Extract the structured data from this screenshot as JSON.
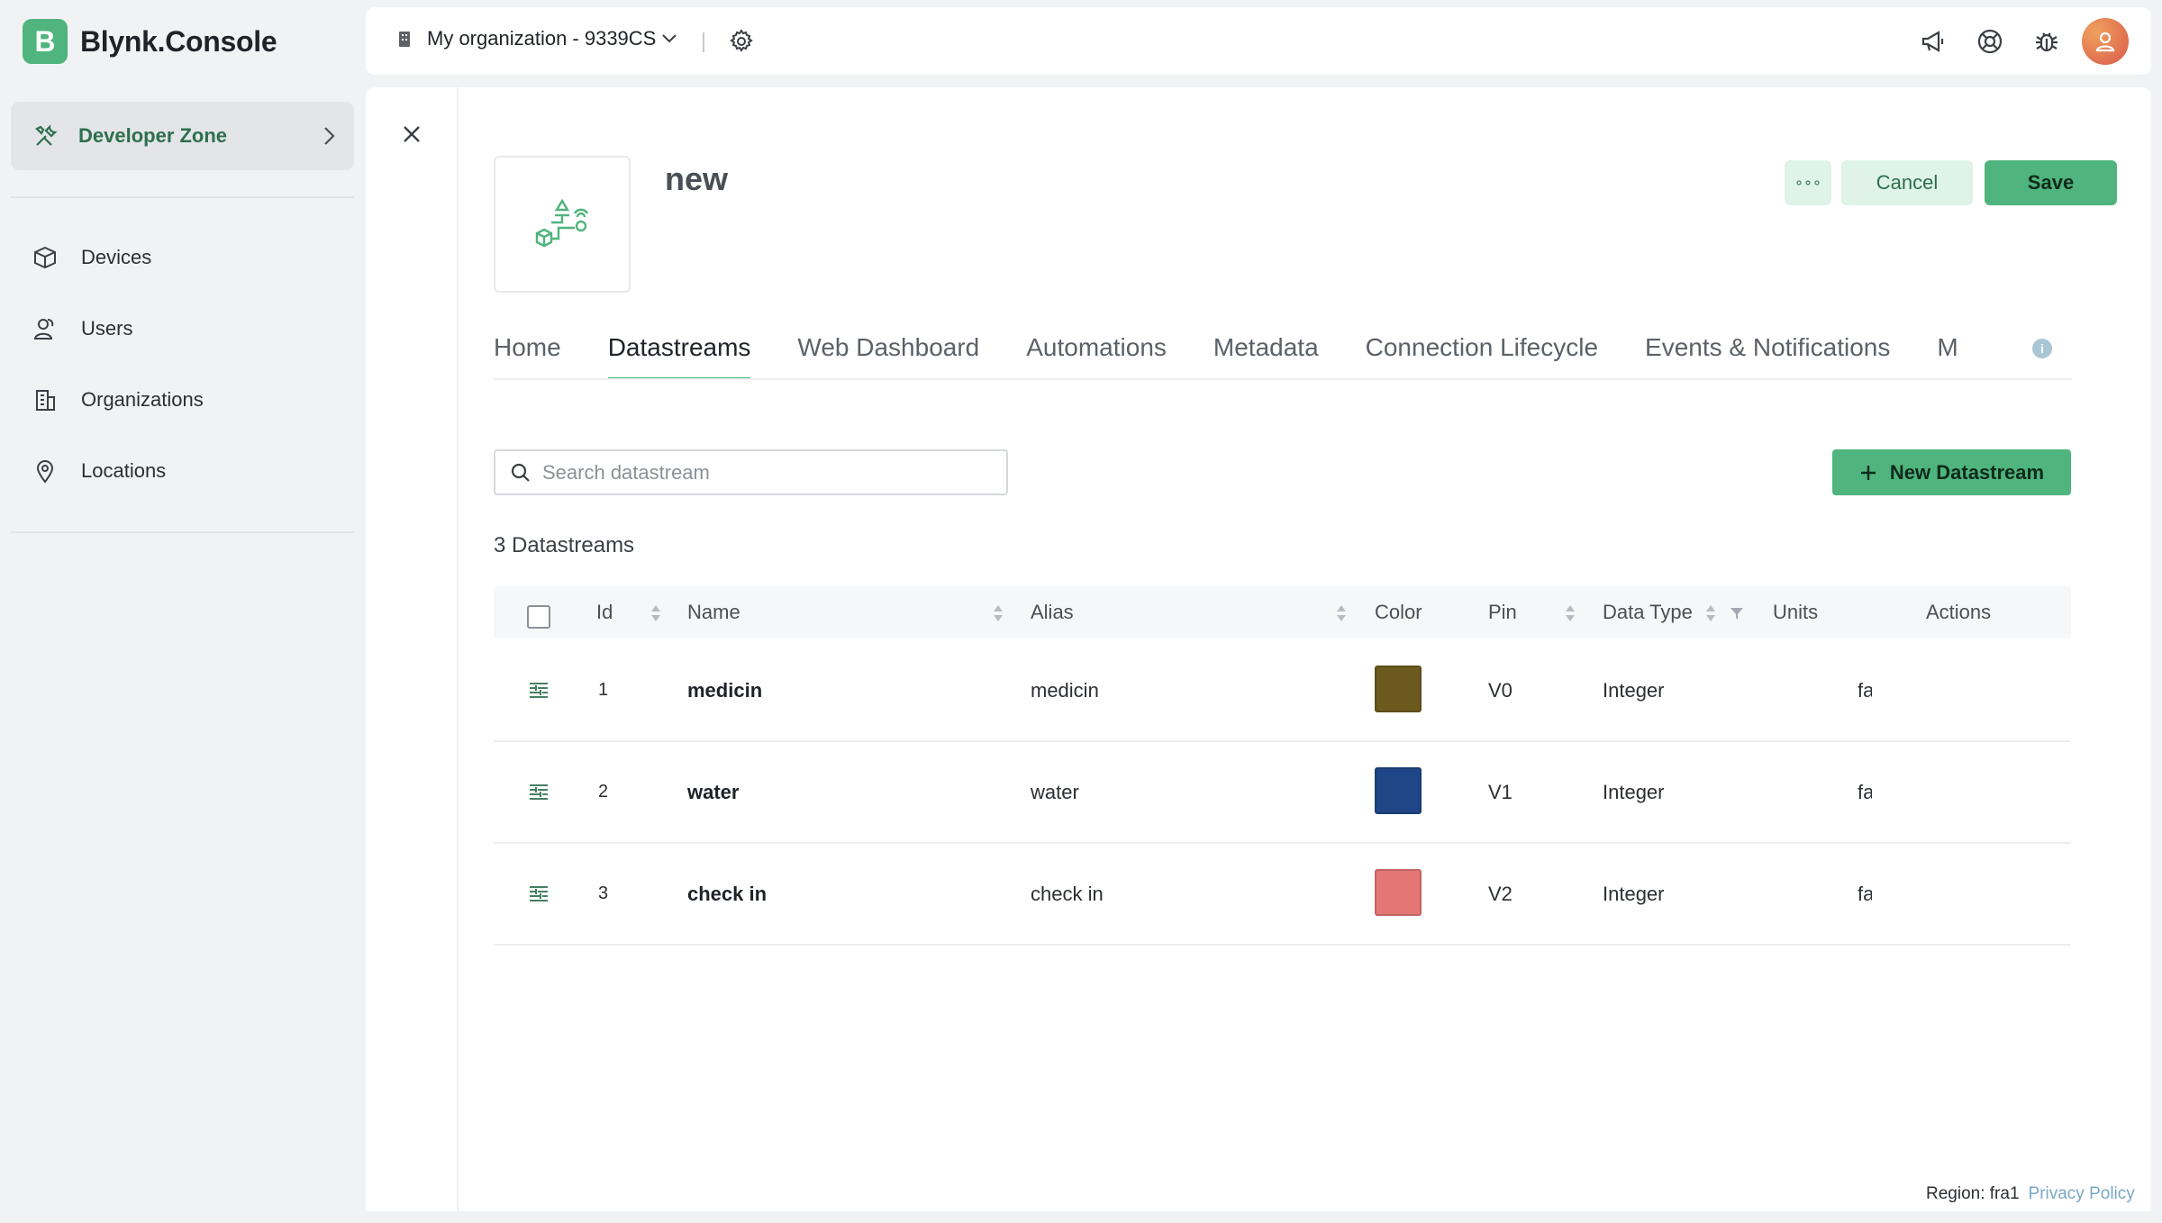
{
  "app": {
    "logo_letter": "B",
    "name": "Blynk.Console"
  },
  "sidebar": {
    "developer_zone": "Developer Zone",
    "items": [
      {
        "label": "Devices",
        "icon": "cube-icon"
      },
      {
        "label": "Users",
        "icon": "users-icon"
      },
      {
        "label": "Organizations",
        "icon": "building-icon"
      },
      {
        "label": "Locations",
        "icon": "location-pin-icon"
      }
    ]
  },
  "topbar": {
    "organization": "My organization - 9339CS"
  },
  "template": {
    "name": "new",
    "more_label": "∘∘∘",
    "cancel_label": "Cancel",
    "save_label": "Save"
  },
  "tabs": [
    {
      "label": "Home",
      "active": false
    },
    {
      "label": "Datastreams",
      "active": true
    },
    {
      "label": "Web Dashboard",
      "active": false
    },
    {
      "label": "Automations",
      "active": false
    },
    {
      "label": "Metadata",
      "active": false
    },
    {
      "label": "Connection Lifecycle",
      "active": false
    },
    {
      "label": "Events & Notifications",
      "active": false
    },
    {
      "label": "M",
      "active": false
    }
  ],
  "info_badge": "i",
  "search": {
    "placeholder": "Search datastream"
  },
  "new_datastream_label": "New Datastream",
  "count_label": "3 Datastreams",
  "table": {
    "headers": {
      "id": "Id",
      "name": "Name",
      "alias": "Alias",
      "color": "Color",
      "pin": "Pin",
      "data_type": "Data Type",
      "units": "Units",
      "actions": "Actions"
    },
    "rows": [
      {
        "id": "1",
        "name": "medicin",
        "alias": "medicin",
        "color": "#6b5a1e",
        "pin": "V0",
        "data_type": "Integer",
        "units": "fa"
      },
      {
        "id": "2",
        "name": "water",
        "alias": "water",
        "color": "#1f4787",
        "pin": "V1",
        "data_type": "Integer",
        "units": "fa"
      },
      {
        "id": "3",
        "name": "check in",
        "alias": "check in",
        "color": "#e47676",
        "pin": "V2",
        "data_type": "Integer",
        "units": "fa"
      }
    ]
  },
  "footer": {
    "region": "Region: fra1",
    "privacy": "Privacy Policy"
  },
  "colors": {
    "accent": "#4fb47d",
    "accent_light": "#dff3e8",
    "dark_green": "#2d6f4d"
  }
}
